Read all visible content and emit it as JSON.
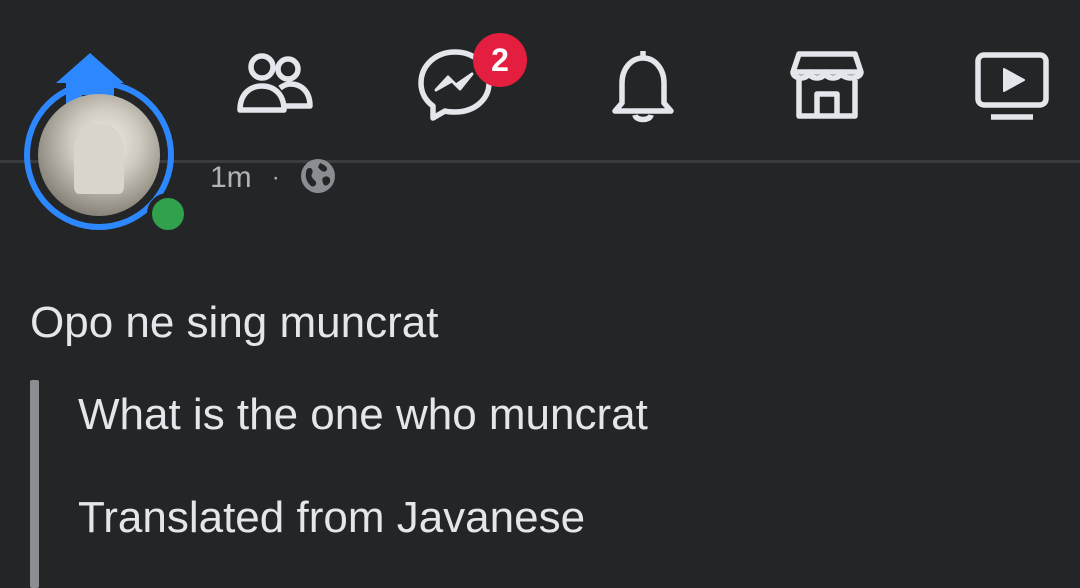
{
  "nav": {
    "tabs": [
      {
        "id": "home",
        "icon": "home-icon",
        "active": true
      },
      {
        "id": "friends",
        "icon": "friends-icon",
        "active": false
      },
      {
        "id": "messenger",
        "icon": "messenger-icon",
        "active": false,
        "badge": "2"
      },
      {
        "id": "notifications",
        "icon": "bell-icon",
        "active": false
      },
      {
        "id": "marketplace",
        "icon": "marketplace-icon",
        "active": false
      },
      {
        "id": "watch",
        "icon": "watch-icon",
        "active": false
      }
    ],
    "active_color": "#2d88ff",
    "icon_color": "#e4e6eb",
    "badge_color": "#e41e3f"
  },
  "post": {
    "time": "1m",
    "separator": "·",
    "privacy_icon": "globe-icon",
    "online_color": "#31a24c",
    "text": "Opo ne sing muncrat",
    "translation": {
      "text": "What is the one who muncrat",
      "note": "Translated from Javanese"
    }
  }
}
